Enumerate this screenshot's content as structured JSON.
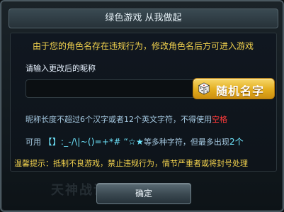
{
  "dialog": {
    "title": "绿色游戏 从我做起",
    "message": "由于您的角色名存在违规行为，修改角色名后方可进入游戏",
    "prompt": "请输入更改后的昵称",
    "name_input": {
      "value": "",
      "placeholder": ""
    },
    "random_button_label": "随机名字",
    "rules": {
      "line1_prefix": "昵称长度不超过6个汉字或者12个英文字符，不得使用",
      "line1_highlight": "空格",
      "line2_prefix": "可用",
      "line2_chars": "【】:_-/\\|~()=+*# “☆★",
      "line2_middle": "等多种字符，但最多出现",
      "line2_count": "2个"
    },
    "warning": "温馨提示：抵制不良游戏，禁止违规行为，情节严重者或将封号处理",
    "watermark": "天神战语",
    "confirm_label": "确定"
  },
  "colors": {
    "accent_yellow": "#f2d24e",
    "text_blue": "#a7cbe3",
    "highlight_red": "#ff3a3a",
    "highlight_cyan": "#6fe7ff",
    "random_button_gold": "#e3ad1e"
  },
  "icons": {
    "random_button_icon": "dice-icon"
  }
}
